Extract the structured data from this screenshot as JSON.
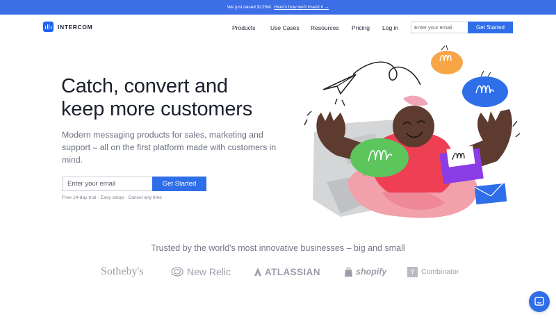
{
  "announcement": {
    "text": "We just raised $125M.",
    "link": "Here's how we'll invest it →"
  },
  "nav": {
    "brand": "INTERCOM",
    "links": [
      {
        "label": "Products"
      },
      {
        "label": "Use Cases"
      },
      {
        "label": "Resources"
      },
      {
        "label": "Pricing"
      },
      {
        "label": "Log in"
      }
    ],
    "email_placeholder": "Enter your email",
    "cta": "Get Started"
  },
  "hero": {
    "title_line1": "Catch, convert and",
    "title_line2": "keep more customers",
    "subtitle": "Modern messaging products for sales, marketing and support – all on the first platform made with customers in mind.",
    "email_placeholder": "Enter your email",
    "cta": "Get Started",
    "note": "Free 14-day trial · Easy setup · Cancel any time"
  },
  "trusted": {
    "heading": "Trusted by the world's most innovative businesses – big and small",
    "logos": {
      "sothebys": "Sotheby's",
      "newrelic": "New Relic",
      "atlassian": "ATLASSIAN",
      "shopify": "shopify",
      "yc_letter": "Y",
      "combinator": "Combinator"
    }
  },
  "colors": {
    "brand_blue": "#2f6ee9",
    "announce_blue": "#3c6ee6",
    "text_dark": "#1a1f2c",
    "text_muted": "#6a7080"
  },
  "icons": {
    "chat_launcher": "chat-bubble-icon",
    "brand": "intercom-logo-icon"
  }
}
